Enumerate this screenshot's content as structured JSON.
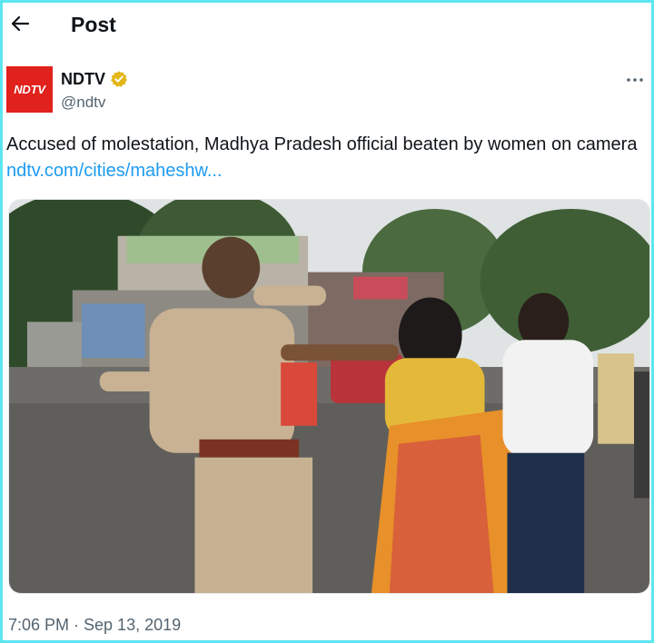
{
  "header": {
    "title": "Post",
    "back_icon": "arrow-left-icon"
  },
  "author": {
    "avatar_text": "NDTV",
    "name": "NDTV",
    "handle": "@ndtv",
    "verified_icon": "verified-badge-icon",
    "more_icon": "ellipsis-icon"
  },
  "tweet": {
    "text": "Accused of molestation, Madhya Pradesh official beaten by women on camera",
    "link": "ndtv.com/cities/maheshw..."
  },
  "media": {
    "kind": "photo",
    "description_icon": "photo-icon"
  },
  "timestamp": "7:06 PM · Sep 13, 2019",
  "colors": {
    "link": "#1d9bf0",
    "brand_red": "#e0211c",
    "verified_gold": "#e2b719",
    "secondary_text": "#536471",
    "frame_border": "#5ce6f0"
  }
}
